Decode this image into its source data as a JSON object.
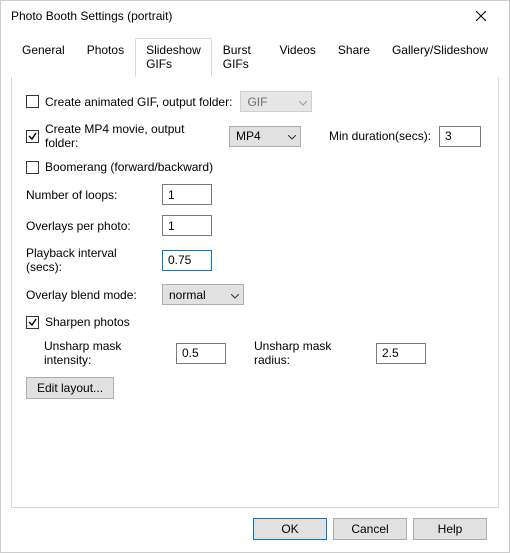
{
  "window": {
    "title": "Photo Booth Settings (portrait)"
  },
  "tabs": {
    "general": "General",
    "photos": "Photos",
    "slideshow_gifs": "Slideshow GIFs",
    "burst_gifs": "Burst GIFs",
    "videos": "Videos",
    "share": "Share",
    "gallery_slideshow": "Gallery/Slideshow"
  },
  "form": {
    "create_gif_label": "Create animated GIF, output folder:",
    "gif_folder": "GIF",
    "create_mp4_label": "Create MP4 movie, output folder:",
    "mp4_folder": "MP4",
    "min_duration_label": "Min duration(secs):",
    "min_duration_value": "3",
    "boomerang_label": "Boomerang (forward/backward)",
    "loops_label": "Number of loops:",
    "loops_value": "1",
    "overlays_label": "Overlays per photo:",
    "overlays_value": "1",
    "playback_label": "Playback interval (secs):",
    "playback_value": "0.75",
    "blend_label": "Overlay blend mode:",
    "blend_value": "normal",
    "sharpen_label": "Sharpen photos",
    "unsharp_intensity_label": "Unsharp mask intensity:",
    "unsharp_intensity_value": "0.5",
    "unsharp_radius_label": "Unsharp mask radius:",
    "unsharp_radius_value": "2.5",
    "edit_layout": "Edit layout..."
  },
  "footer": {
    "ok": "OK",
    "cancel": "Cancel",
    "help": "Help"
  }
}
